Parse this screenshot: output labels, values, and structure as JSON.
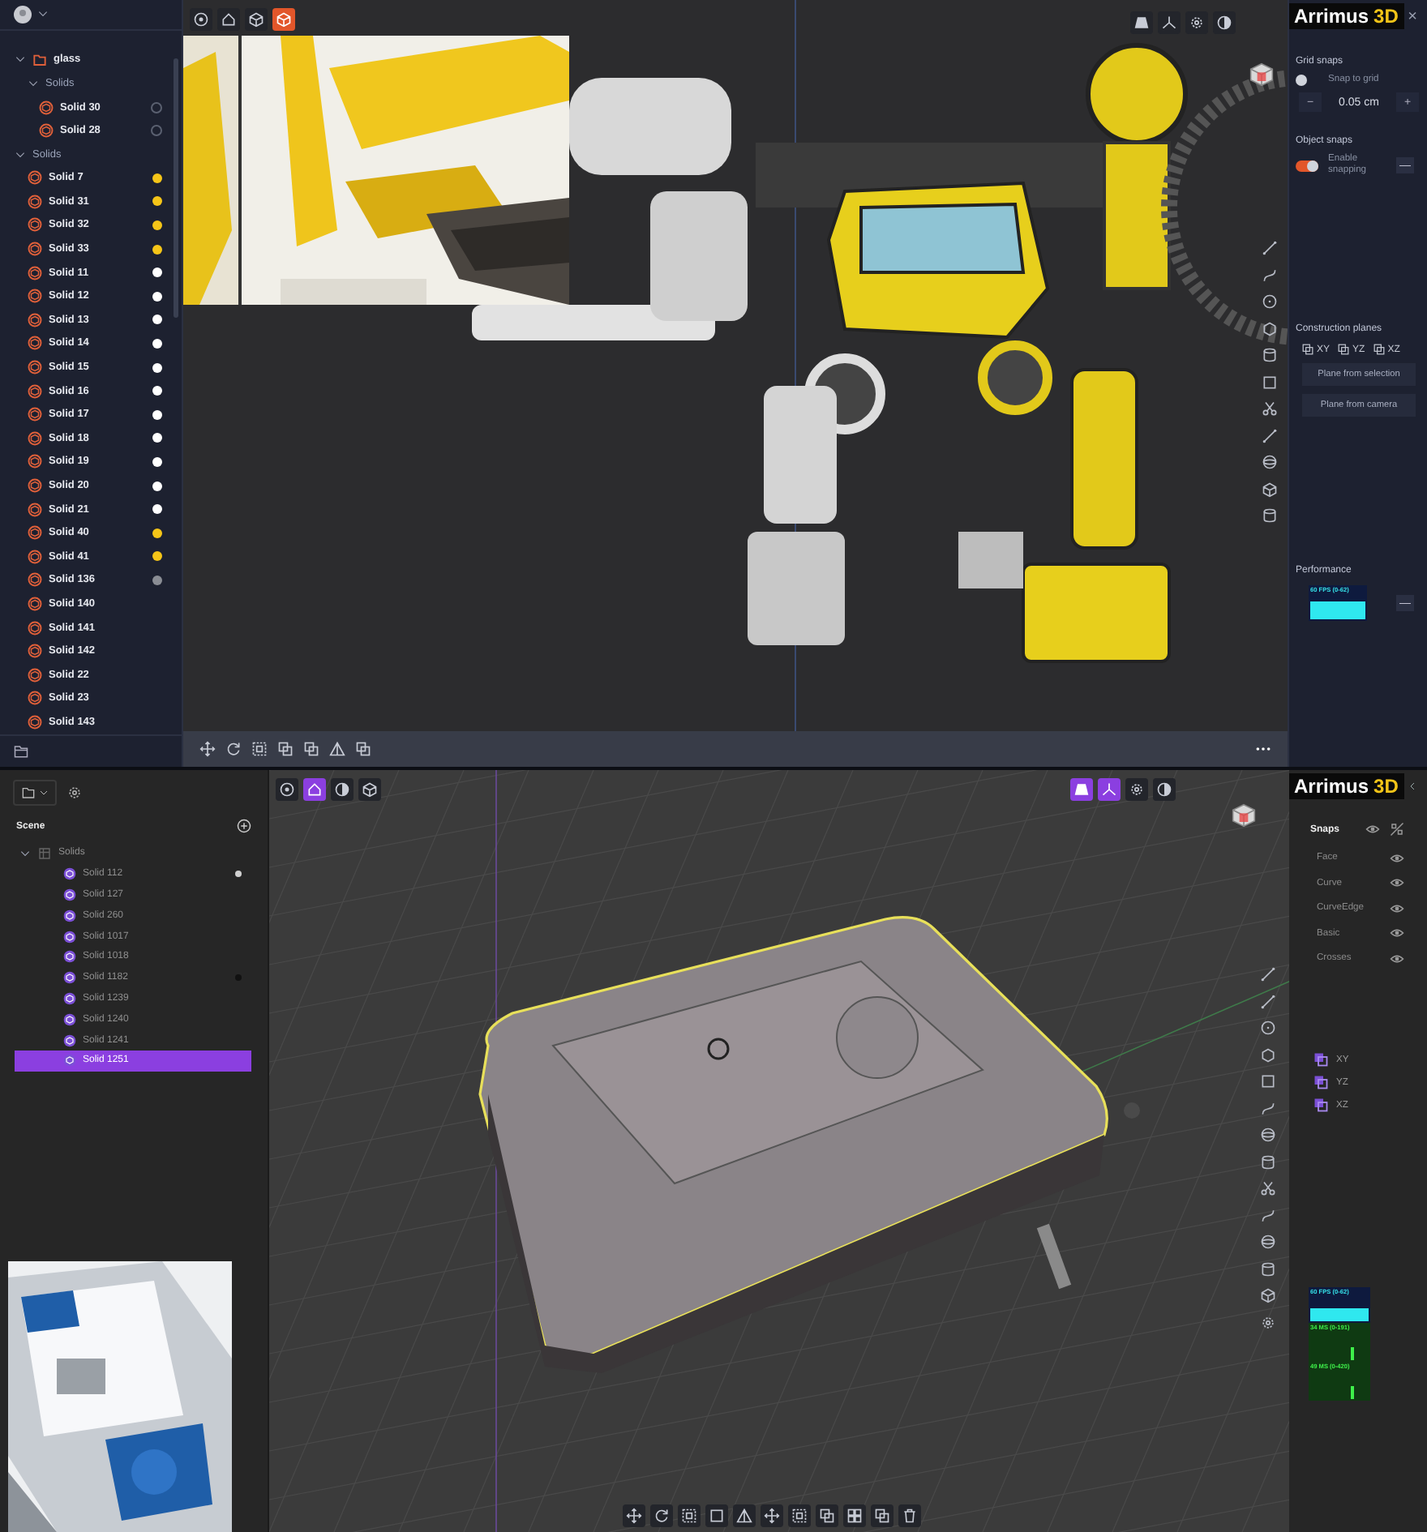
{
  "top": {
    "sidebar": {
      "tree": [
        {
          "label": "glass",
          "kind": "folder",
          "expanded": true,
          "children": [
            {
              "label": "Solids",
              "kind": "group",
              "expanded": true,
              "children": [
                {
                  "label": "Solid 30",
                  "kind": "solid",
                  "color": "#5a6070",
                  "hollow": true
                },
                {
                  "label": "Solid 28",
                  "kind": "solid",
                  "color": "#5a6070",
                  "hollow": true
                }
              ]
            }
          ]
        },
        {
          "label": "Solids",
          "kind": "group",
          "expanded": true,
          "children": [
            {
              "label": "Solid 7",
              "kind": "solid",
              "color": "#f5c518"
            },
            {
              "label": "Solid 31",
              "kind": "solid",
              "color": "#f5c518"
            },
            {
              "label": "Solid 32",
              "kind": "solid",
              "color": "#f5c518"
            },
            {
              "label": "Solid 33",
              "kind": "solid",
              "color": "#f5c518"
            },
            {
              "label": "Solid 11",
              "kind": "solid",
              "color": "#ffffff"
            },
            {
              "label": "Solid 12",
              "kind": "solid",
              "color": "#ffffff"
            },
            {
              "label": "Solid 13",
              "kind": "solid",
              "color": "#ffffff"
            },
            {
              "label": "Solid 14",
              "kind": "solid",
              "color": "#ffffff"
            },
            {
              "label": "Solid 15",
              "kind": "solid",
              "color": "#ffffff"
            },
            {
              "label": "Solid 16",
              "kind": "solid",
              "color": "#ffffff"
            },
            {
              "label": "Solid 17",
              "kind": "solid",
              "color": "#ffffff"
            },
            {
              "label": "Solid 18",
              "kind": "solid",
              "color": "#ffffff"
            },
            {
              "label": "Solid 19",
              "kind": "solid",
              "color": "#ffffff"
            },
            {
              "label": "Solid 20",
              "kind": "solid",
              "color": "#ffffff"
            },
            {
              "label": "Solid 21",
              "kind": "solid",
              "color": "#ffffff"
            },
            {
              "label": "Solid 40",
              "kind": "solid",
              "color": "#f5c518"
            },
            {
              "label": "Solid 41",
              "kind": "solid",
              "color": "#f5c518"
            },
            {
              "label": "Solid 136",
              "kind": "solid",
              "color": "#8a8d94"
            },
            {
              "label": "Solid 140",
              "kind": "solid"
            },
            {
              "label": "Solid 141",
              "kind": "solid"
            },
            {
              "label": "Solid 142",
              "kind": "solid"
            },
            {
              "label": "Solid 22",
              "kind": "solid"
            },
            {
              "label": "Solid 23",
              "kind": "solid"
            },
            {
              "label": "Solid 143",
              "kind": "solid"
            }
          ]
        }
      ]
    },
    "viewport": {
      "tools_left": [
        {
          "kind": "target",
          "selected": false
        },
        {
          "kind": "home",
          "selected": false
        },
        {
          "kind": "cube",
          "selected": false
        },
        {
          "kind": "cube",
          "selected": true
        }
      ],
      "tools_right": [
        {
          "kind": "shade",
          "selected": false
        },
        {
          "kind": "axes",
          "selected": false
        },
        {
          "kind": "gear",
          "selected": false
        },
        {
          "kind": "contrast",
          "selected": false
        }
      ],
      "side_tools": [
        {
          "kind": "line"
        },
        {
          "kind": "curve"
        },
        {
          "kind": "circle"
        },
        {
          "kind": "hexagon"
        },
        {
          "kind": "cylinder"
        },
        {
          "kind": "square"
        },
        {
          "kind": "scissors"
        },
        {
          "kind": "line"
        },
        {
          "kind": "sphere"
        },
        {
          "kind": "cube"
        },
        {
          "kind": "cylinder"
        }
      ],
      "bottom_tools": [
        {
          "kind": "move"
        },
        {
          "kind": "rotate"
        },
        {
          "kind": "scale"
        },
        {
          "kind": "overlap"
        },
        {
          "kind": "overlap"
        },
        {
          "kind": "triangle"
        },
        {
          "kind": "overlap"
        }
      ],
      "more": {
        "kind": "more"
      }
    },
    "panel": {
      "logo": {
        "name": "Arrimus",
        "mark": "3D"
      },
      "close": "×",
      "grid_snaps": {
        "title": "Grid snaps",
        "toggle": {
          "label": "Snap to grid",
          "on": false
        },
        "minus": "−",
        "value": "0.05 cm",
        "plus": "+"
      },
      "object_snaps": {
        "title": "Object snaps",
        "toggle": {
          "label": "Enable snapping",
          "on": true
        },
        "button": "—"
      },
      "planes": {
        "title": "Construction planes",
        "items": [
          "XY",
          "YZ",
          "XZ"
        ],
        "buttons": [
          "Plane from selection",
          "Plane from camera"
        ]
      },
      "performance": {
        "title": "Performance",
        "label": "60 FPS (0-62)",
        "button": "—"
      }
    }
  },
  "bottom": {
    "sidebar": {
      "title": "Scene",
      "tree": [
        {
          "label": "Solids",
          "expanded": true,
          "children": [
            {
              "label": "Solid 112",
              "selected": false,
              "color": "#d0d0d0"
            },
            {
              "label": "Solid 127",
              "selected": false
            },
            {
              "label": "Solid 260",
              "selected": false
            },
            {
              "label": "Solid 1017",
              "selected": false
            },
            {
              "label": "Solid 1018",
              "selected": false
            },
            {
              "label": "Solid 1182",
              "selected": false,
              "color": "#111111"
            },
            {
              "label": "Solid 1239",
              "selected": false
            },
            {
              "label": "Solid 1240",
              "selected": false
            },
            {
              "label": "Solid 1241",
              "selected": false
            },
            {
              "label": "Solid 1251",
              "selected": true
            }
          ]
        }
      ]
    },
    "viewport": {
      "tools_left": [
        {
          "kind": "target",
          "selected": false
        },
        {
          "kind": "home",
          "selected": true
        },
        {
          "kind": "contrast",
          "selected": false
        },
        {
          "kind": "cube",
          "selected": false
        }
      ],
      "tools_right": [
        {
          "kind": "shade",
          "selected": true
        },
        {
          "kind": "axes",
          "selected": true
        },
        {
          "kind": "gear",
          "selected": false
        },
        {
          "kind": "contrast",
          "selected": false
        }
      ],
      "side_tools": [
        {
          "kind": "line"
        },
        {
          "kind": "line"
        },
        {
          "kind": "circle"
        },
        {
          "kind": "hexagon"
        },
        {
          "kind": "square"
        },
        {
          "kind": "curve"
        },
        {
          "kind": "sphere"
        },
        {
          "kind": "cylinder"
        },
        {
          "kind": "scissors"
        },
        {
          "kind": "curve"
        },
        {
          "kind": "sphere"
        },
        {
          "kind": "cylinder"
        },
        {
          "kind": "cube"
        },
        {
          "kind": "gear"
        }
      ],
      "bottom_tools": [
        {
          "kind": "move"
        },
        {
          "kind": "rotate"
        },
        {
          "kind": "scale"
        },
        {
          "kind": "square"
        },
        {
          "kind": "triangle"
        },
        {
          "kind": "move"
        },
        {
          "kind": "scale"
        },
        {
          "kind": "overlap"
        },
        {
          "kind": "grid"
        },
        {
          "kind": "overlap"
        },
        {
          "kind": "trash"
        }
      ]
    },
    "panel": {
      "logo": {
        "name": "Arrimus",
        "mark": "3D"
      },
      "snaps": {
        "title": "Snaps",
        "items": [
          "Face",
          "Curve",
          "CurveEdge",
          "Basic",
          "Crosses"
        ]
      },
      "planes": [
        "XY",
        "YZ",
        "XZ"
      ],
      "performance": [
        {
          "label": "60 FPS (0-62)",
          "kind": "fps"
        },
        {
          "label": "34 MS (0-191)",
          "kind": "ms"
        },
        {
          "label": "49 MS (0-420)",
          "kind": "ms"
        }
      ]
    }
  }
}
